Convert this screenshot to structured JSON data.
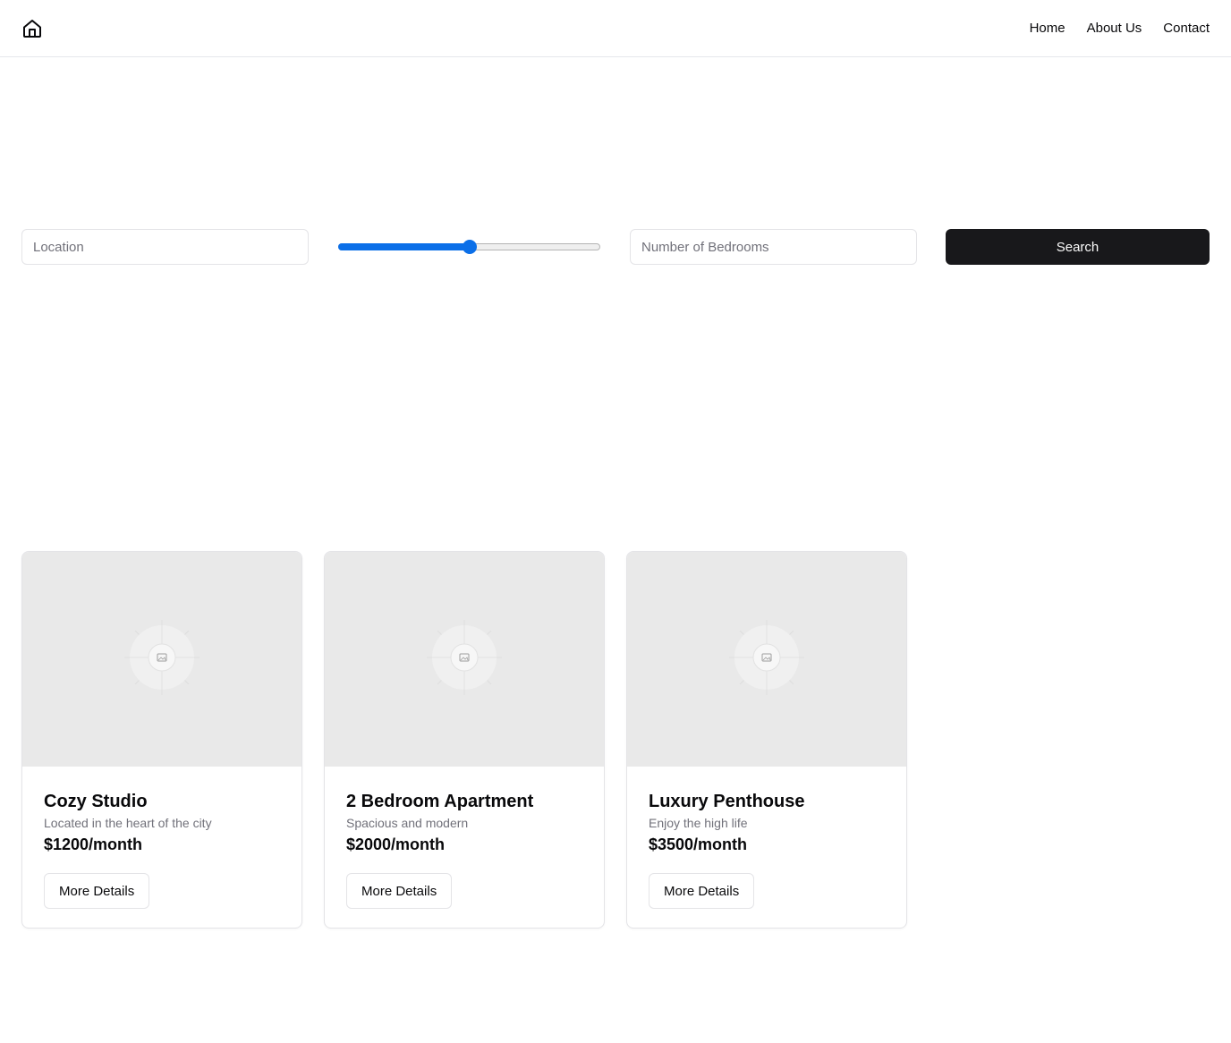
{
  "header": {
    "logo_icon": "home-icon",
    "nav": {
      "home": "Home",
      "about": "About Us",
      "contact": "Contact"
    }
  },
  "search": {
    "location_placeholder": "Location",
    "location_value": "",
    "price_slider_level": 0.5,
    "bedrooms_placeholder": "Number of Bedrooms",
    "bedrooms_value": "",
    "search_label": "Search",
    "accent_color": "#0b6fe8"
  },
  "listings": [
    {
      "title": "Cozy Studio",
      "description": "Located in the heart of the city",
      "price": "$1200/month",
      "button_label": "More Details",
      "image_icon": "image-placeholder-icon"
    },
    {
      "title": "2 Bedroom Apartment",
      "description": "Spacious and modern",
      "price": "$2000/month",
      "button_label": "More Details",
      "image_icon": "image-placeholder-icon"
    },
    {
      "title": "Luxury Penthouse",
      "description": "Enjoy the high life",
      "price": "$3500/month",
      "button_label": "More Details",
      "image_icon": "image-placeholder-icon"
    }
  ]
}
